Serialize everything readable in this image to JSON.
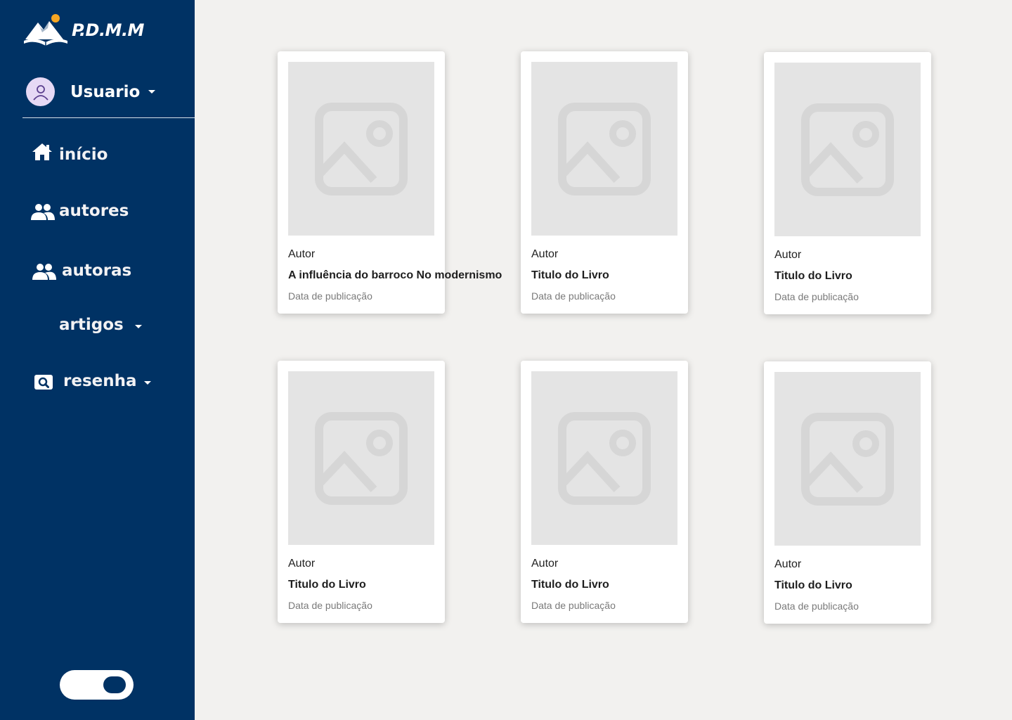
{
  "brand": {
    "name": "P.D.M.M",
    "logo_icon": "book-mountain-logo"
  },
  "user": {
    "name": "Usuario",
    "avatar_icon": "user-icon"
  },
  "nav": {
    "inicio": "início",
    "autores": "autores",
    "autoras": "autoras",
    "artigos": "artigos",
    "resenha": "resenha"
  },
  "theme_toggle": {
    "state": "on"
  },
  "books": [
    {
      "author": "Autor",
      "title": "A influência do barroco No modernismo",
      "date": "Data de publicação"
    },
    {
      "author": "Autor",
      "title": "Titulo do Livro",
      "date": "Data de publicação"
    },
    {
      "author": "Autor",
      "title": "Titulo do Livro",
      "date": "Data de publicação"
    },
    {
      "author": "Autor",
      "title": "Titulo do Livro",
      "date": "Data de publicação"
    },
    {
      "author": "Autor",
      "title": "Titulo do Livro",
      "date": "Data de publicação"
    },
    {
      "author": "Autor",
      "title": "Titulo do Livro",
      "date": "Data de publicação"
    }
  ],
  "colors": {
    "sidebar": "#003264",
    "background": "#f2f1ef",
    "placeholder": "#e4e4e4"
  }
}
